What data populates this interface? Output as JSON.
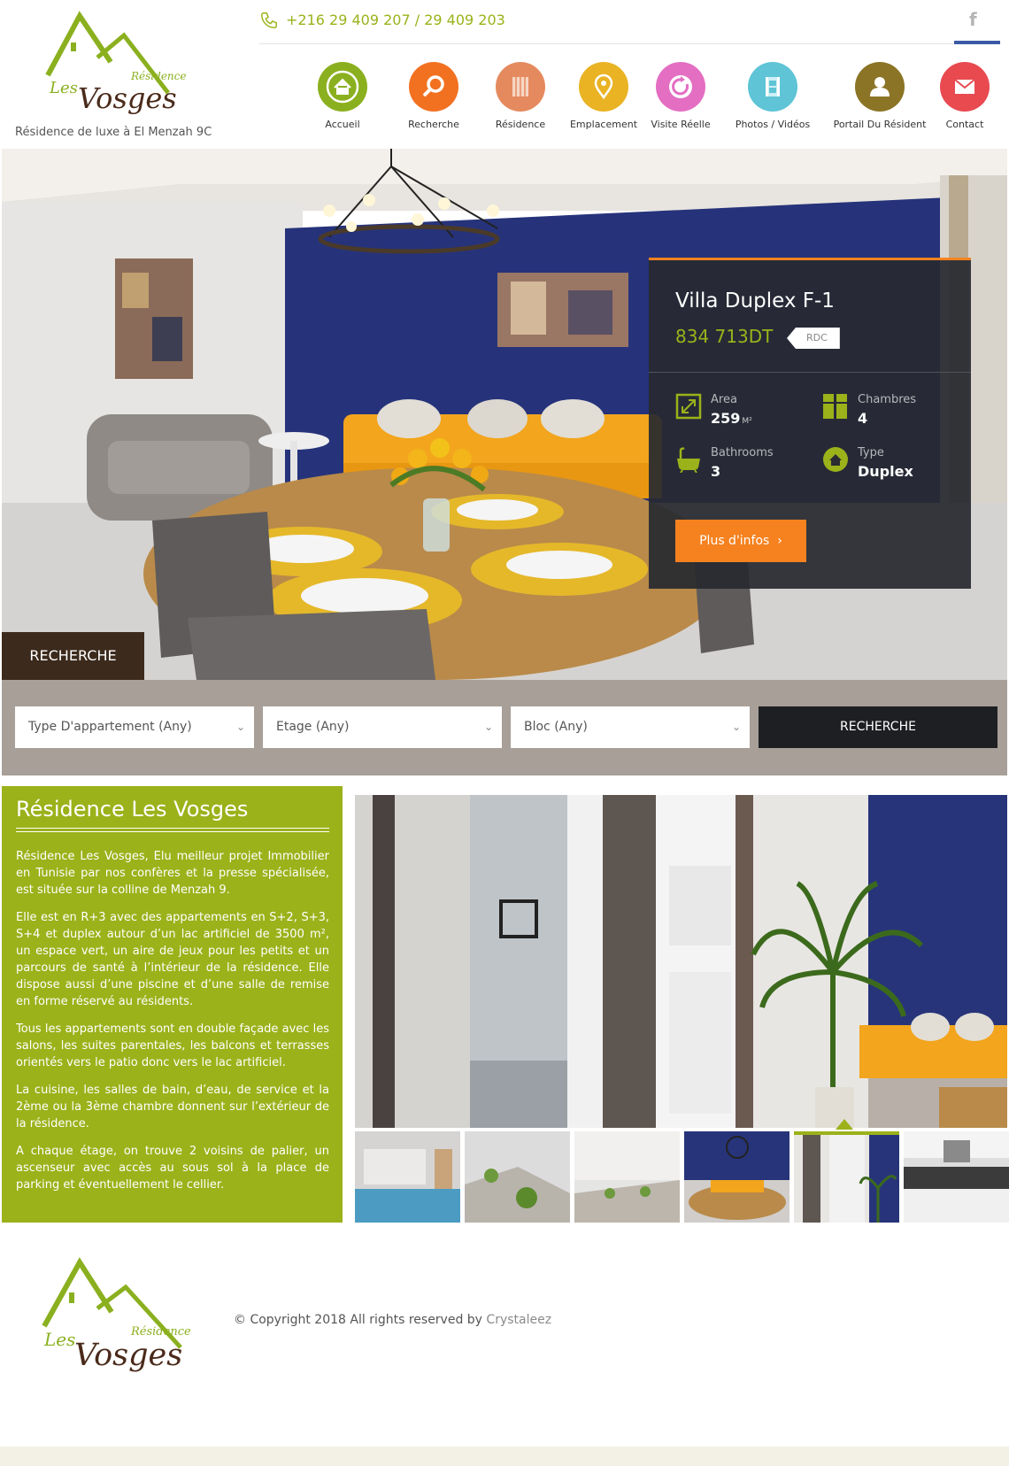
{
  "header": {
    "logo_text_top": "Résidences",
    "logo_text_les": "Les",
    "logo_text_main": "Vosges",
    "tagline": "Résidence de luxe à El Menzah 9C",
    "phone": "+216 29 409 207 / 29 409 203",
    "facebook_glyph": "f"
  },
  "nav": {
    "items": [
      {
        "label": "Accueil",
        "icon": "home-icon",
        "color": "#8bb01f"
      },
      {
        "label": "Recherche",
        "icon": "search-icon",
        "color": "#f27121"
      },
      {
        "label": "Résidence",
        "icon": "building-icon",
        "color": "#e58a5e"
      },
      {
        "label": "Emplacement",
        "icon": "map-pin-icon",
        "color": "#e9b324"
      },
      {
        "label": "Visite Réelle",
        "icon": "refresh-icon",
        "color": "#e36ec2"
      },
      {
        "label": "Photos / Vidéos",
        "icon": "film-icon",
        "color": "#5ec4d6"
      },
      {
        "label": "Portail Du Résident",
        "icon": "user-icon",
        "color": "#8b7425"
      },
      {
        "label": "Contact",
        "icon": "mail-icon",
        "color": "#e84a50"
      }
    ]
  },
  "property": {
    "title": "Villa Duplex F-1",
    "price": "834 713DT",
    "badge": "RDC",
    "specs": {
      "area_label": "Area",
      "area_value": "259",
      "area_unit": "M²",
      "chambres_label": "Chambres",
      "chambres_value": "4",
      "bathrooms_label": "Bathrooms",
      "bathrooms_value": "3",
      "type_label": "Type",
      "type_value": "Duplex"
    },
    "button": "Plus d'infos",
    "button_arrow": "›"
  },
  "search": {
    "tab_label": "RECHERCHE",
    "selects": [
      {
        "label": "Type D'appartement (Any)"
      },
      {
        "label": "Etage (Any)"
      },
      {
        "label": "Bloc (Any)"
      }
    ],
    "chevron": "⌄",
    "button": "RECHERCHE"
  },
  "about": {
    "title": "Résidence Les Vosges",
    "paragraphs": [
      "Résidence Les Vosges, Elu meilleur projet Immobilier en Tunisie par nos confères et la presse spécialisée, est située sur la colline de Menzah 9.",
      "Elle est en R+3 avec des appartements en S+2, S+3, S+4 et duplex autour d’un lac artificiel de 3500 m², un espace vert, un aire de jeux pour les petits et un parcours de santé à l’intérieur de la résidence. Elle dispose aussi d’une piscine et d’une salle de remise en forme réservé au résidents.",
      "Tous les appartements sont en double façade avec les salons, les suites parentales, les balcons et terrasses orientés vers le patio donc vers le lac artificiel.",
      "La cuisine, les salles de bain, d’eau, de service et la 2ème ou la 3ème chambre donnent sur l’extérieur de la résidence.",
      "A chaque étage, on trouve 2 voisins de palier, un ascenseur avec accès au sous sol à la place de parking et éventuellement le cellier."
    ]
  },
  "footer": {
    "copyright": "© Copyright 2018 All rights reserved by",
    "link": "Crystaleez"
  },
  "colors": {
    "accent_green": "#9bb21a",
    "accent_orange": "#f5821f",
    "dark": "#1d1f22",
    "brown": "#3c2a1c"
  }
}
